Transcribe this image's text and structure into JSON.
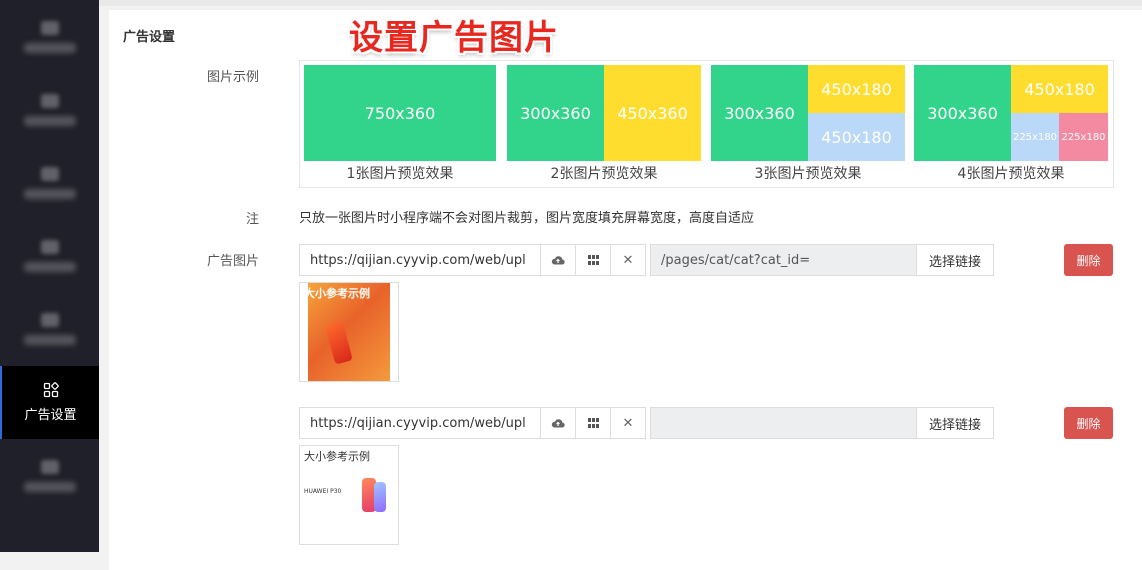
{
  "sidebar": {
    "active_label": "广告设置",
    "active_icon": "apps-icon"
  },
  "panel": {
    "title": "广告设置",
    "banner": "设置广告图片"
  },
  "labels": {
    "example": "图片示例",
    "note": "注",
    "ad_image": "广告图片"
  },
  "examples": [
    {
      "caption": "1张图片预览效果",
      "blocks": [
        "750x360"
      ]
    },
    {
      "caption": "2张图片预览效果",
      "blocks": [
        "300x360",
        "450x360"
      ]
    },
    {
      "caption": "3张图片预览效果",
      "blocks": [
        "300x360",
        "450x180",
        "450x180"
      ]
    },
    {
      "caption": "4张图片预览效果",
      "blocks": [
        "300x360",
        "450x180",
        "225x180",
        "225x180"
      ]
    }
  ],
  "note_text": "只放一张图片时小程序端不会对图片裁剪，图片宽度填充屏幕宽度，高度自适应",
  "ads": [
    {
      "url": "https://qijian.cyyvip.com/web/upl",
      "link": "/pages/cat/cat?cat_id=",
      "link_button": "选择链接",
      "delete": "删除",
      "thumb_caption": "大小参考示例"
    },
    {
      "url": "https://qijian.cyyvip.com/web/upl",
      "link": "",
      "link_button": "选择链接",
      "delete": "删除",
      "thumb_caption": "大小参考示例",
      "thumb_product": "HUAWEI P30"
    }
  ],
  "colors": {
    "green": "#32d38a",
    "yellow": "#fedd2f",
    "blue": "#bad8f8",
    "pink": "#f48aa1",
    "danger": "#d9534f"
  }
}
